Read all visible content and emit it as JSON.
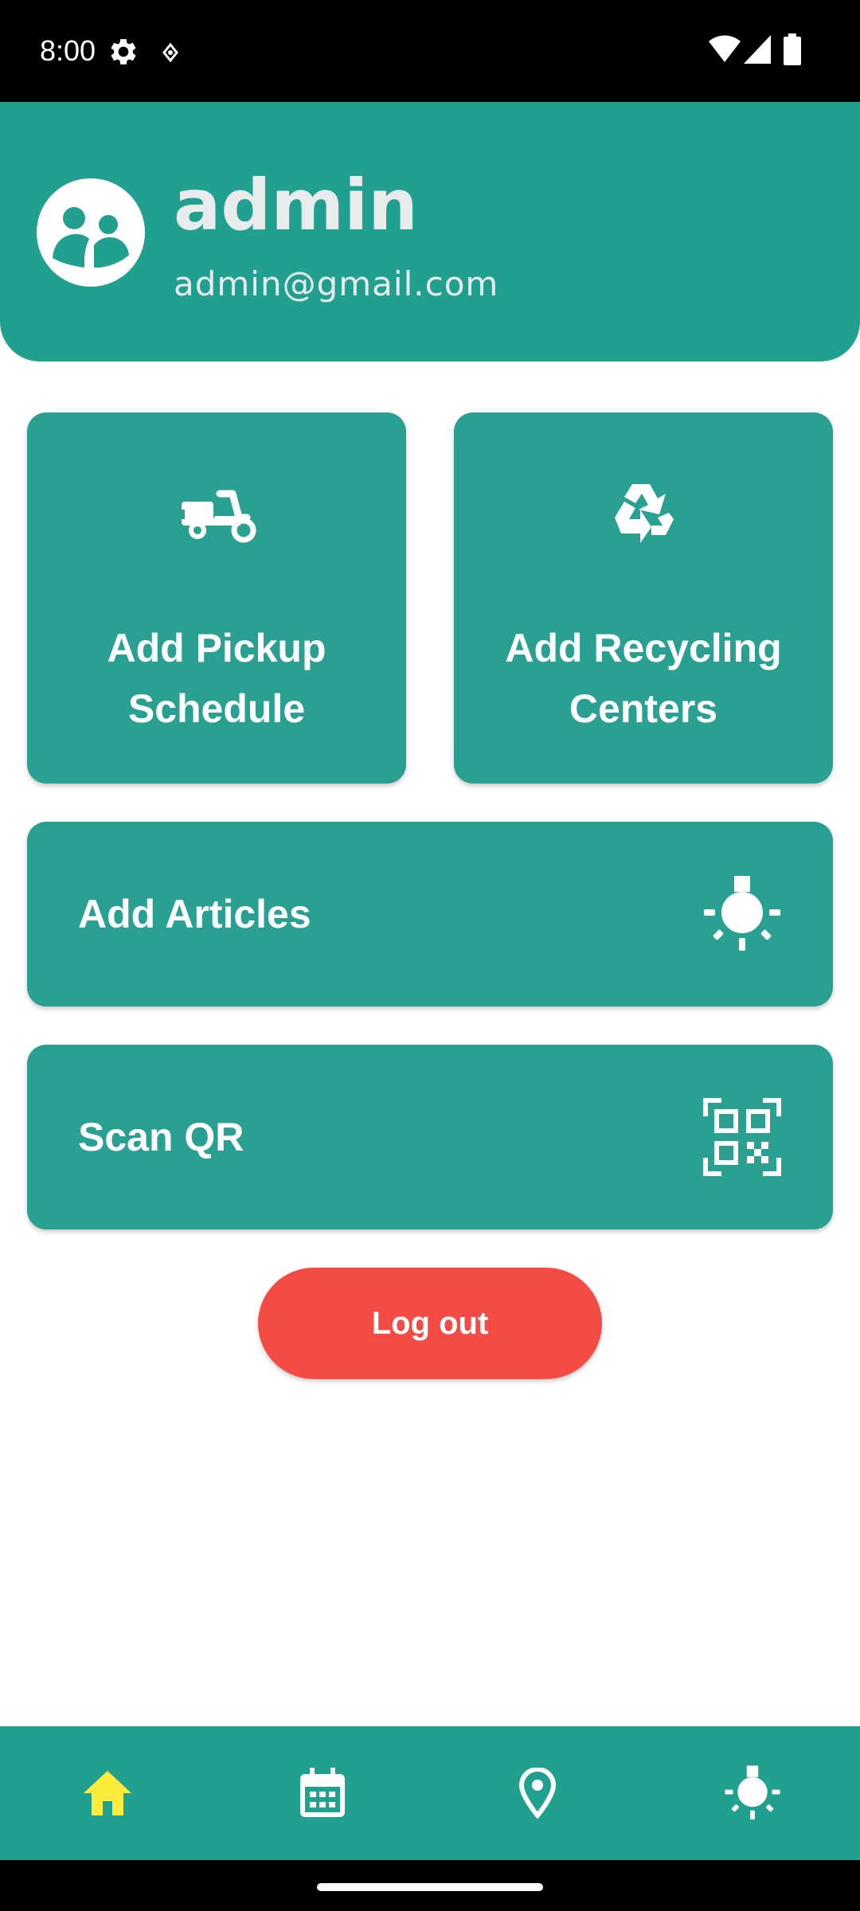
{
  "status_bar": {
    "time": "8:00",
    "icons": [
      "settings-gear-icon",
      "notification-icon",
      "wifi-icon",
      "signal-icon",
      "battery-icon"
    ]
  },
  "profile": {
    "name": "admin",
    "email": "admin@gmail.com",
    "avatar_icon": "user-account-icon"
  },
  "actions": {
    "pickup": {
      "label": "Add Pickup Schedule",
      "icon": "scooter-icon"
    },
    "recycling": {
      "label": "Add Recycling Centers",
      "icon": "recycle-icon"
    },
    "articles": {
      "label": "Add Articles",
      "icon": "light-bulb-icon"
    },
    "scan": {
      "label": "Scan QR",
      "icon": "qr-code-icon"
    }
  },
  "logout": {
    "label": "Log out"
  },
  "bottom_nav": {
    "items": [
      {
        "name": "home",
        "icon": "home-icon",
        "active": true
      },
      {
        "name": "schedule",
        "icon": "calendar-icon",
        "active": false
      },
      {
        "name": "locations",
        "icon": "location-pin-icon",
        "active": false
      },
      {
        "name": "tips",
        "icon": "light-bulb-icon",
        "active": false
      }
    ]
  },
  "colors": {
    "primary": "#21a08f",
    "card": "#2aa093",
    "logout": "#f44b44",
    "active_nav": "#ffeb3b",
    "header_text": "#e8ecec"
  }
}
